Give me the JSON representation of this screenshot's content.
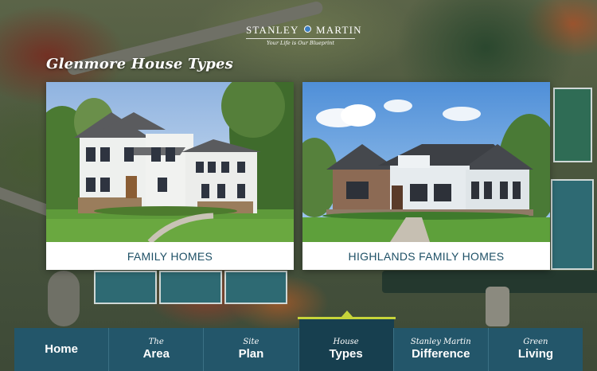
{
  "brand": {
    "name_left": "STANLEY",
    "name_right": "MARTIN",
    "tagline": "Your Life is Our Blueprint"
  },
  "page_title": "Glenmore House Types",
  "cards": [
    {
      "label": "FAMILY HOMES",
      "photo_icon": "family-home-photo"
    },
    {
      "label": "HIGHLANDS FAMILY HOMES",
      "photo_icon": "highlands-home-photo"
    }
  ],
  "nav": {
    "items": [
      {
        "small": "",
        "big": "Home"
      },
      {
        "small": "The",
        "big": "Area"
      },
      {
        "small": "Site",
        "big": "Plan"
      },
      {
        "small": "House",
        "big": "Types"
      },
      {
        "small": "Stanley Martin",
        "big": "Difference"
      },
      {
        "small": "Green",
        "big": "Living"
      }
    ],
    "active_index": 3
  },
  "colors": {
    "nav_bg": "#23566a",
    "nav_active": "#173f4f",
    "accent": "#c6d43a",
    "card_label": "#1e5066"
  }
}
